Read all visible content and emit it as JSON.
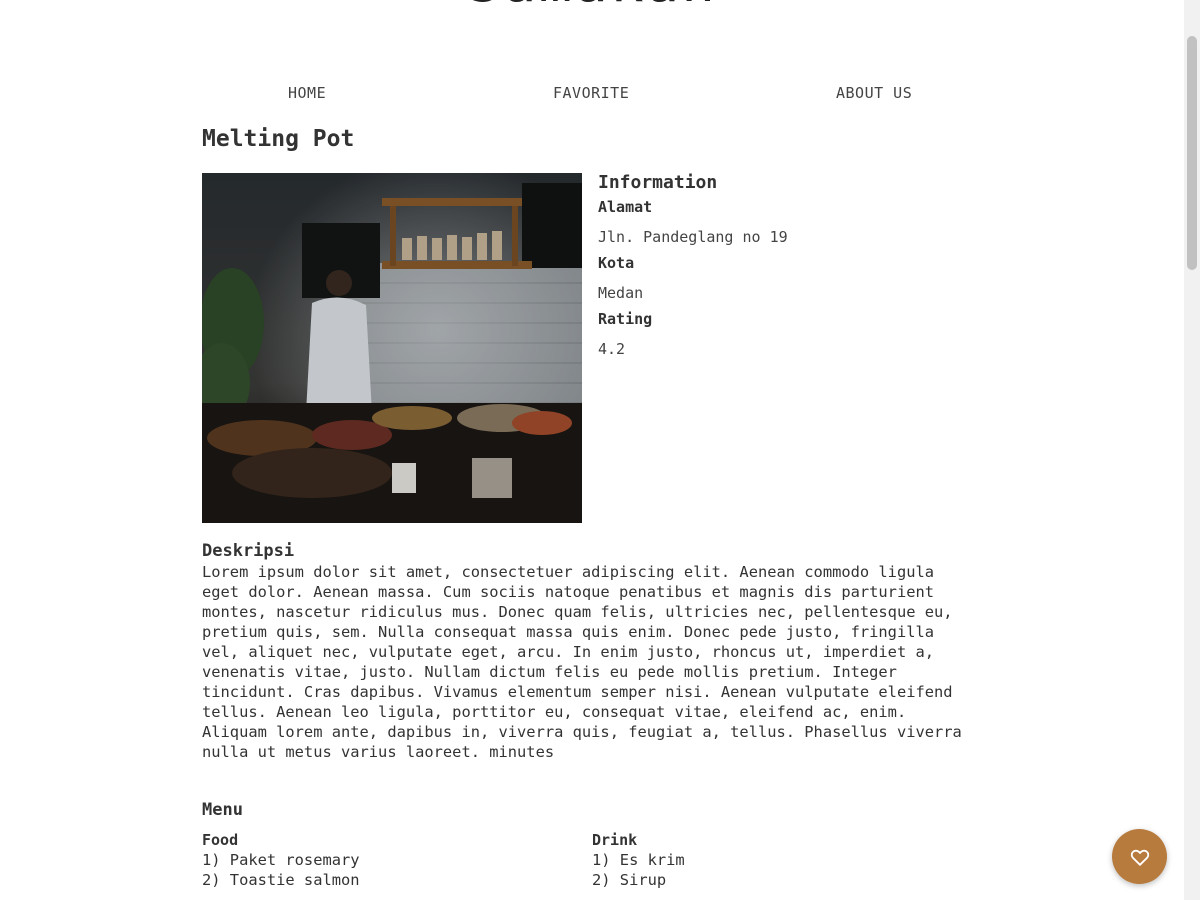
{
  "site": {
    "brand": "Samakan"
  },
  "nav": {
    "home": "HOME",
    "favorite": "FAVORITE",
    "about": "ABOUT US"
  },
  "restaurant": {
    "name": "Melting Pot",
    "info_heading": "Information",
    "alamat_label": "Alamat",
    "alamat": "Jln. Pandeglang no 19",
    "kota_label": "Kota",
    "kota": "Medan",
    "rating_label": "Rating",
    "rating": "4.2"
  },
  "description": {
    "heading": "Deskripsi",
    "text": "Lorem ipsum dolor sit amet, consectetuer adipiscing elit. Aenean commodo ligula eget dolor. Aenean massa. Cum sociis natoque penatibus et magnis dis parturient montes, nascetur ridiculus mus. Donec quam felis, ultricies nec, pellentesque eu, pretium quis, sem. Nulla consequat massa quis enim. Donec pede justo, fringilla vel, aliquet nec, vulputate eget, arcu. In enim justo, rhoncus ut, imperdiet a, venenatis vitae, justo. Nullam dictum felis eu pede mollis pretium. Integer tincidunt. Cras dapibus. Vivamus elementum semper nisi. Aenean vulputate eleifend tellus. Aenean leo ligula, porttitor eu, consequat vitae, eleifend ac, enim. Aliquam lorem ante, dapibus in, viverra quis, feugiat a, tellus. Phasellus viverra nulla ut metus varius laoreet. minutes"
  },
  "menu": {
    "heading": "Menu",
    "food_heading": "Food",
    "food": [
      "1) Paket rosemary",
      "2) Toastie salmon"
    ],
    "drink_heading": "Drink",
    "drink": [
      "1) Es krim",
      "2) Sirup"
    ]
  },
  "favorite_button": {
    "icon": "heart-icon",
    "color": "#b87b3e"
  }
}
